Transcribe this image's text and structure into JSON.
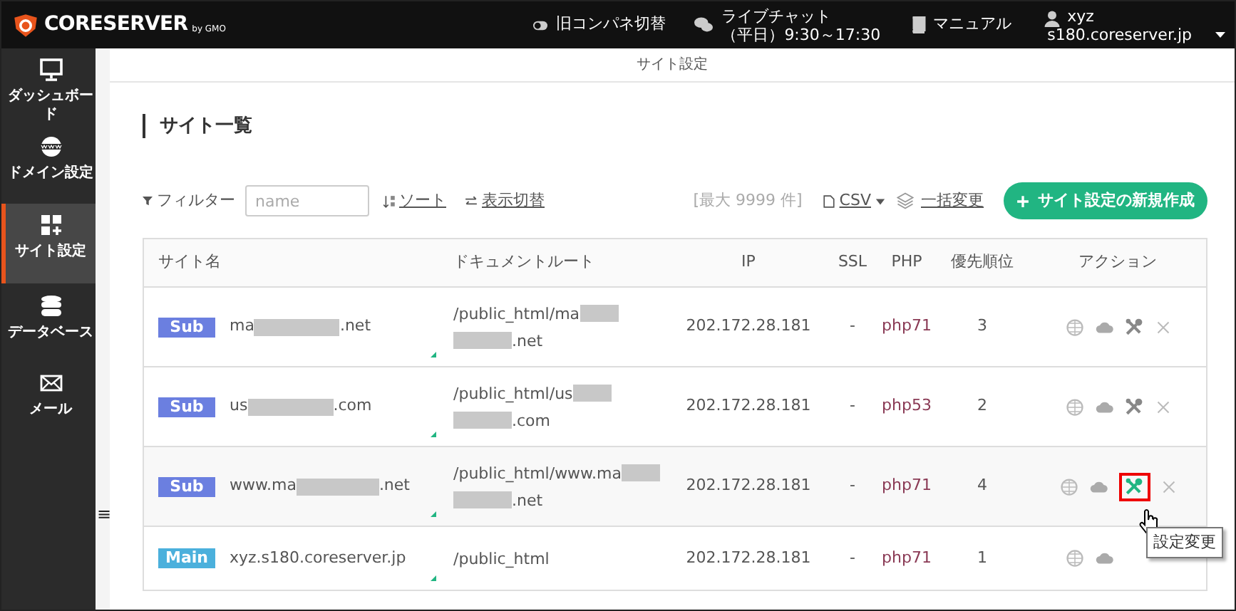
{
  "header": {
    "logo": "CORESERVER",
    "logo_sub": "by GMO",
    "old_panel": "旧コンパネ切替",
    "chat_title": "ライブチャット",
    "chat_hours": "（平日）9:30～17:30",
    "manual": "マニュアル",
    "user": "xyz",
    "server": "s180.coreserver.jp"
  },
  "sidebar": {
    "items": [
      {
        "kind": "monitor",
        "label": "ダッシュボード",
        "selected": false
      },
      {
        "kind": "www",
        "label": "ドメイン設定",
        "selected": false
      },
      {
        "kind": "grid",
        "label": "サイト設定",
        "selected": true
      },
      {
        "kind": "database",
        "label": "データベース",
        "selected": false
      },
      {
        "kind": "mail",
        "label": "メール",
        "selected": false
      }
    ],
    "toggle": "≡"
  },
  "breadcrumb": "サイト設定",
  "heading": "サイト一覧",
  "toolbar": {
    "filter_label": "フィルター",
    "filter_placeholder": "name",
    "sort": "ソート",
    "display": "表示切替",
    "max": "[最大 9999 件]",
    "csv": "CSV",
    "bulk": "一括変更",
    "create": "サイト設定の新規作成"
  },
  "table": {
    "columns": [
      "サイト名",
      "ドキュメントルート",
      "IP",
      "SSL",
      "PHP",
      "優先順位",
      "アクション"
    ],
    "rows": [
      {
        "type": "Sub",
        "name_start": "ma",
        "name_end": ".net",
        "root": [
          {
            "start": "/public_html/ma"
          },
          {
            "end": ".net"
          }
        ],
        "ip": "202.172.28.181",
        "ssl": "-",
        "php": "php71",
        "priority": "3",
        "hovered_action": false,
        "actions_visible": true
      },
      {
        "type": "Sub",
        "name_start": "us",
        "name_end": ".com",
        "root": [
          {
            "start": "/public_html/us"
          },
          {
            "end": ".com"
          }
        ],
        "ip": "202.172.28.181",
        "ssl": "-",
        "php": "php53",
        "priority": "2",
        "hovered_action": false,
        "actions_visible": true
      },
      {
        "type": "Sub",
        "name_start": "www.ma",
        "name_end": ".net",
        "root": [
          {
            "start": "/public_html/www.ma"
          },
          {
            "end": ".net"
          }
        ],
        "ip": "202.172.28.181",
        "ssl": "-",
        "php": "php71",
        "priority": "4",
        "hovered_action": true,
        "actions_visible": true
      },
      {
        "type": "Main",
        "name_start": "xyz.s180.coreserver.jp",
        "root": [
          {
            "start": "/public_html"
          }
        ],
        "ip": "202.172.28.181",
        "ssl": "-",
        "php": "php71",
        "priority": "1",
        "hovered_action": false,
        "actions_visible": false
      }
    ]
  },
  "tooltip": "設定変更"
}
